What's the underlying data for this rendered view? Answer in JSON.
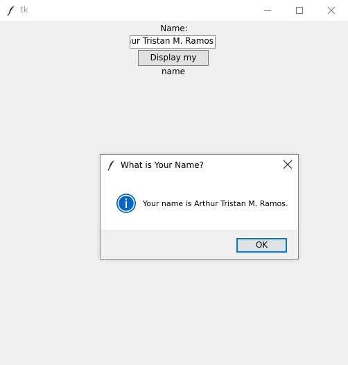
{
  "window": {
    "title": "tk",
    "app_icon": "feather-icon",
    "controls": [
      "minimize-icon",
      "maximize-icon",
      "close-icon"
    ]
  },
  "form": {
    "name_label": "Name:",
    "name_value": "Arthur Tristan M. Ramos",
    "display_button": "Display my name"
  },
  "dialog": {
    "title": "What is Your Name?",
    "icon": "info-icon",
    "message": "Your name is Arthur Tristan M. Ramos.",
    "ok_button": "OK",
    "colors": {
      "accent": "#0078d7",
      "info": "#0066cc"
    }
  }
}
